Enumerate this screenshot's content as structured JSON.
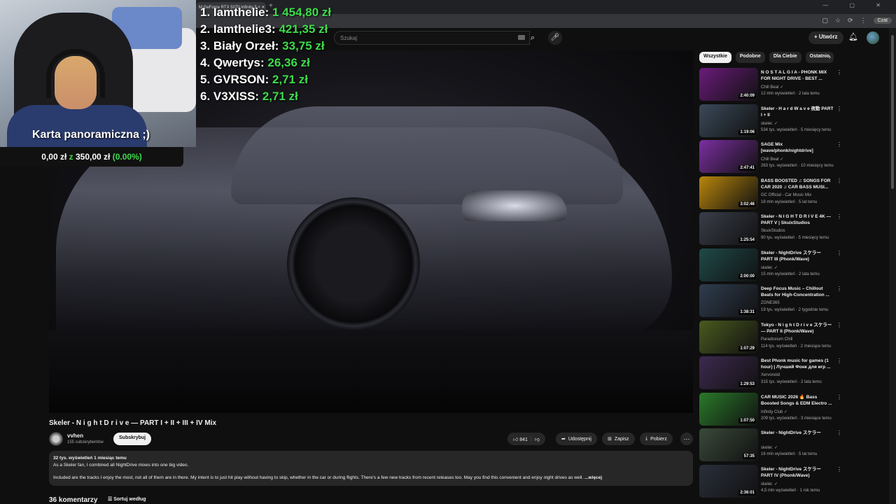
{
  "browser": {
    "tab_title": "M GeForce RTX 5070 Infinity 3 × ✕",
    "new_tab": "+",
    "window_controls": "— ▢ ✕",
    "profile_label": "Czat"
  },
  "header": {
    "search_placeholder": "Szukaj",
    "create_label": "+ Utwórz"
  },
  "overlay": {
    "leaderboard": [
      {
        "name": "1. Iamthelie:",
        "amount": "1 454,80 zł"
      },
      {
        "name": "2. Iamthelie3:",
        "amount": "421,35 zł"
      },
      {
        "name": "3. Biały Orzeł:",
        "amount": "33,75 zł"
      },
      {
        "name": "4. Qwertys:",
        "amount": "26,36 zł"
      },
      {
        "name": "5. GVRSON:",
        "amount": "2,71 zł"
      },
      {
        "name": "6. V3XISS:",
        "amount": "2,71 zł"
      }
    ],
    "webcam_label": "Karta panoramiczna ;)",
    "donation_current": "0,00 zł",
    "donation_sep": "z",
    "donation_goal": "350,00 zł",
    "donation_percent": "(0.00%)"
  },
  "video": {
    "title": "Skeler - N i g h t D r i v e — PART I + II + III + IV Mix",
    "channel": "vvhen",
    "subscribers": "155 subskrybentów",
    "subscribe_label": "Subskrybuj",
    "likes": "841",
    "share_label": "Udostępnij",
    "save_label": "Zapisz",
    "download_label": "Pobierz",
    "stats": "32 tys. wyświetleń  1 miesiąc temu",
    "desc_line1": "As a Skeler fan, I combined all NightDrive mixes into one big video.",
    "desc_line2": "Included are the tracks I enjoy the most, not all of them are in there. My intent is to just hit play without having to skip, whether in the car or during flights. There's a few new tracks from recent releases too. May you find this convenient and enjoy night drives as well.",
    "more_label": "...więcej",
    "comments": "36 komentarzy",
    "sort_label": "Sortuj według"
  },
  "chips": [
    "Wszystkie",
    "Podobne",
    "Dla Ciebie",
    "Ostatnio"
  ],
  "recommendations": [
    {
      "title": "N O S T A L G I A - PHONK MIX FOR NIGHT DRIVE - BEST ...",
      "channel": "Chill Beat ✓",
      "meta": "12 mln wyświetleń · 2 lata temu",
      "duration": "2:40:09",
      "color": "#6a1b7a"
    },
    {
      "title": "Skeler - H a r d W a v e 夜動 PART I + II",
      "channel": "skeler. ✓",
      "meta": "534 tys. wyświetleń · 5 miesięcy temu",
      "duration": "1:19:06",
      "color": "#3b4a5a"
    },
    {
      "title": "SAGE Mix [wave/phonk/nightdrive]",
      "channel": "Chill Beat ✓",
      "meta": "263 tys. wyświetleń · 10 miesięcy temu",
      "duration": "2:47:41",
      "color": "#7b2fa0"
    },
    {
      "title": "BASS BOOSTED ♫ SONGS FOR CAR 2020 ♫ CAR BASS MUSI...",
      "channel": "GC Official - Car Music Mix",
      "meta": "18 mln wyświetleń · 5 lat temu",
      "duration": "3:02:46",
      "color": "#b8860b"
    },
    {
      "title": "Skeler - N I G H T D R I V E 4K — PART V | SkuixStudios",
      "channel": "SkuixStudios",
      "meta": "90 tys. wyświetleń · 5 miesięcy temu",
      "duration": "1:25:54",
      "color": "#3a3d4a"
    },
    {
      "title": "Skeler - NightDrive スケラー PART III (Phonk/Wave)",
      "channel": "skeler. ✓",
      "meta": "15 mln wyświetleń · 2 lata temu",
      "duration": "2:00:00",
      "color": "#1f4a4a"
    },
    {
      "title": "Deep Focus Music – Chillout Beats for High-Concentration ...",
      "channel": "ZONE365",
      "meta": "19 tys. wyświetleń · 2 tygodnie temu",
      "duration": "1:38:31",
      "color": "#2f3d4f"
    },
    {
      "title": "Tokyo - N i g h t D r i v e スケラー — PART II (Phonk/Wave)",
      "channel": "Paradoxium Chill",
      "meta": "114 tys. wyświetleń · 2 miesiące temu",
      "duration": "1:07:29",
      "color": "#4a5a1f"
    },
    {
      "title": "Best Phonk music for games (1 hour) | Лучший Фонк для игр ...",
      "channel": "Xervonoid",
      "meta": "315 tys. wyświetleń · 2 lata temu",
      "duration": "1:29:53",
      "color": "#3d2a4f"
    },
    {
      "title": "CAR MUSIC 2026 🔥 Bass Boosted Songs & EDM Electro ...",
      "channel": "Infinity Club ✓",
      "meta": "209 tys. wyświetleń · 3 miesiące temu",
      "duration": "1:07:50",
      "color": "#2a7a2a"
    },
    {
      "title": "Skeler - NightDrive スケラー",
      "channel": "skeler. ✓",
      "meta": "16 mln wyświetleń · 5 lat temu",
      "duration": "57:35",
      "color": "#3a4a3a"
    },
    {
      "title": "Skeler - NightDrive スケラー PART IV (Phonk/Wave)",
      "channel": "skeler. ✓",
      "meta": "4,5 mln wyświetleń · 1 rok temu",
      "duration": "2:36:01",
      "color": "#2a2f3a"
    }
  ]
}
